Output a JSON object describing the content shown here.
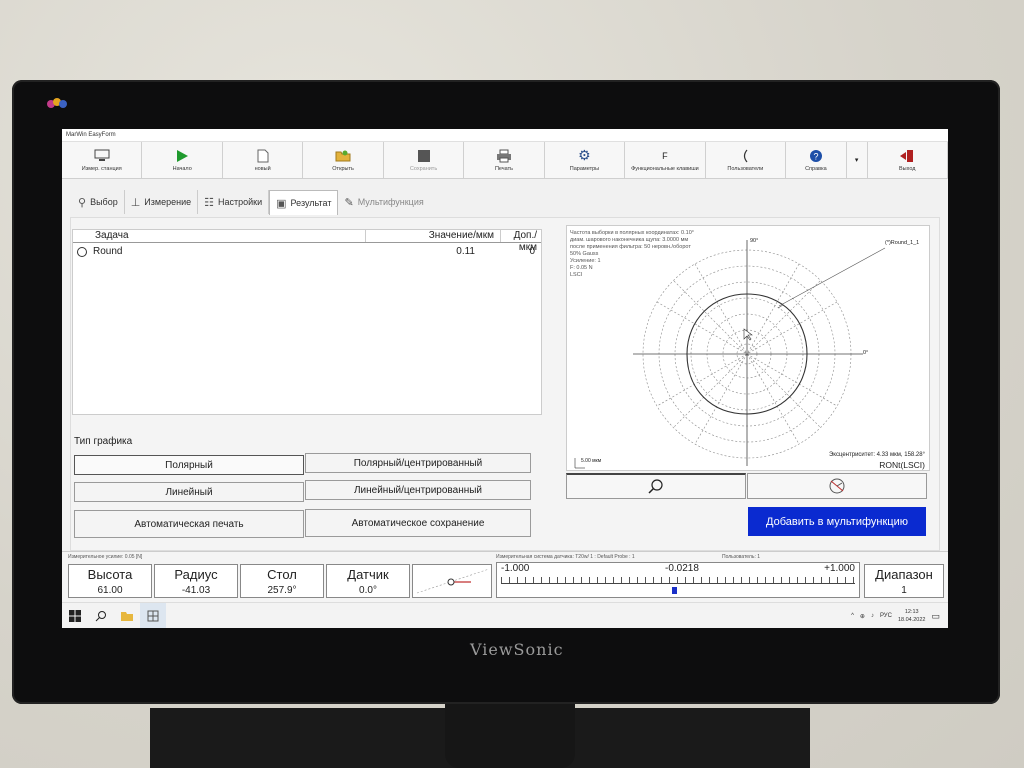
{
  "app": {
    "title": "MarWin EasyForm"
  },
  "device": {
    "brand": "ViewSonic"
  },
  "toolbar": [
    {
      "label": "Измер. станция",
      "icon": "monitor-icon",
      "enabled": true
    },
    {
      "label": "Начало",
      "icon": "play-icon",
      "enabled": true
    },
    {
      "label": "новый",
      "icon": "new-file-icon",
      "enabled": true
    },
    {
      "label": "Открыть",
      "icon": "folder-icon",
      "enabled": true
    },
    {
      "label": "Сохранить",
      "icon": "save-icon",
      "enabled": false
    },
    {
      "label": "Печать",
      "icon": "printer-icon",
      "enabled": true
    },
    {
      "label": "Параметры",
      "icon": "gear-icon",
      "enabled": true
    },
    {
      "label": "Функциональные клавиши",
      "icon": "function-key-icon",
      "enabled": true,
      "glyph": "F"
    },
    {
      "label": "Пользователи",
      "icon": "users-icon",
      "enabled": true
    },
    {
      "label": "Справка",
      "icon": "help-icon",
      "enabled": true
    },
    {
      "label": "Выход",
      "icon": "exit-icon",
      "enabled": true
    }
  ],
  "tabs": [
    {
      "label": "Выбор",
      "icon": "select-icon",
      "enabled": true
    },
    {
      "label": "Измерение",
      "icon": "measure-icon",
      "enabled": true
    },
    {
      "label": "Настройки",
      "icon": "settings-icon",
      "enabled": true
    },
    {
      "label": "Результат",
      "icon": "result-icon",
      "enabled": true
    },
    {
      "label": "Мультифункция",
      "icon": "multifunction-icon",
      "enabled": false
    }
  ],
  "table": {
    "headers": {
      "task": "Задача",
      "value": "Значение/мкм",
      "tol": "Доп./мкм"
    },
    "rows": [
      {
        "task": "Round",
        "value": "0.11",
        "tol": "0"
      }
    ]
  },
  "graph": {
    "title": "Тип графика",
    "buttons": {
      "polar": "Полярный",
      "polar_centered": "Полярный/центрированный",
      "linear": "Линейный",
      "linear_centered": "Линейный/центрированный",
      "auto_print": "Автоматическая печать",
      "auto_save": "Автоматическое сохранение"
    },
    "selected": "polar"
  },
  "plot": {
    "info": [
      "Частота выборки в полярных координатах: 0.10°",
      "диам. шарового наконечника щупа: 3.0000 мм",
      "после применения фильтра: 50 неровн./оборот",
      "50% Gauss",
      "Усиление: 1",
      "F: 0.05 N",
      "LSCI"
    ],
    "angle_top": "90°",
    "angle_right": "0°",
    "feature_label": "(*)Round_1_1",
    "scale": "5.00 мкм",
    "eccentricity": "Эксцентриситет: 4.33 мкм, 158.28°",
    "method": "RONt(LSCI)"
  },
  "add_button": "Добавить в мультифункцию",
  "status": {
    "force": "Измерительное усилие: 0.05 [N]",
    "system": "Измерительная система датчика: T20w/ 1 : Default Probe : 1",
    "user": "Пользователь: 1",
    "height": {
      "label": "Высота",
      "value": "61.00"
    },
    "radius": {
      "label": "Радиус",
      "value": "-41.03"
    },
    "table": {
      "label": "Стол",
      "value": "257.9°"
    },
    "sensor": {
      "label": "Датчик",
      "value": "0.0°"
    },
    "gauge": {
      "min": "-1.000",
      "current": "-0.0218",
      "max": "+1.000",
      "level": 0.489
    },
    "range": {
      "label": "Диапазон",
      "value": "1"
    }
  },
  "taskbar": {
    "lang": "РУС",
    "time": "12:13",
    "date": "18.04.2022"
  }
}
